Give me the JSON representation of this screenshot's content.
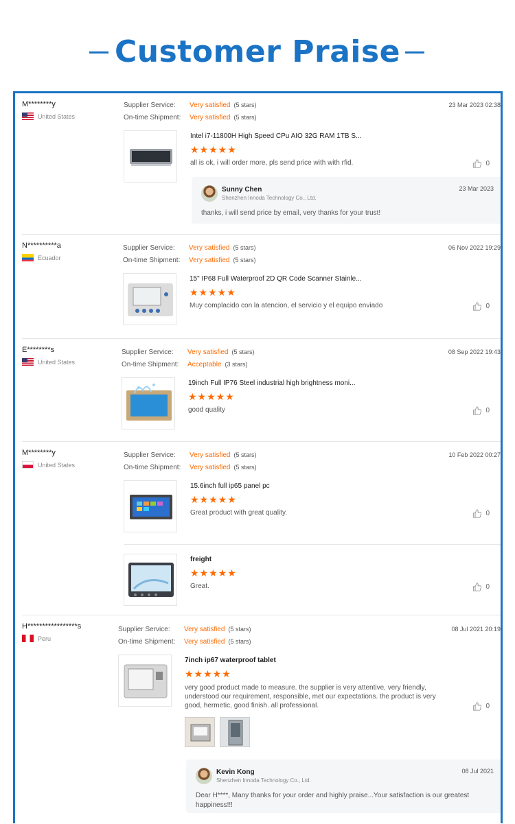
{
  "header": {
    "title": "Customer Praise"
  },
  "labels": {
    "supplier_service": "Supplier Service:",
    "on_time_shipment": "On-time Shipment:"
  },
  "colors": {
    "accent": "#1a73c4",
    "rating": "#ff6a00"
  },
  "reviews": [
    {
      "buyer": "M********y",
      "country": "United States",
      "supplier_service": "Very satisfied",
      "supplier_service_stars": "(5 stars)",
      "shipment": "Very satisfied",
      "shipment_stars": "(5 stars)",
      "date": "23 Mar 2023 02:38",
      "items": [
        {
          "product": "Intel i7-11800H High Speed CPu AIO 32G RAM 1TB S...",
          "stars": "★★★★★",
          "comment": "all is ok, i will order more, pls send price with with rfid.",
          "likes": "0"
        }
      ],
      "reply": {
        "name": "Sunny Chen",
        "company": "Shenzhen Innoda Technology Co., Ltd.",
        "date": "23 Mar 2023",
        "text": "thanks, i will send price by email, very thanks for your trust!"
      }
    },
    {
      "buyer": "N**********a",
      "country": "Ecuador",
      "supplier_service": "Very satisfied",
      "supplier_service_stars": "(5 stars)",
      "shipment": "Very satisfied",
      "shipment_stars": "(5 stars)",
      "date": "06 Nov 2022 19:29",
      "items": [
        {
          "product": "15\" IP68 Full Waterproof 2D QR Code Scanner Stainle...",
          "stars": "★★★★★",
          "comment": "Muy complacido con la atencion, el servicio y el equipo enviado",
          "likes": "0"
        }
      ]
    },
    {
      "buyer": "E********s",
      "country": "United States",
      "supplier_service": "Very satisfied",
      "supplier_service_stars": "(5 stars)",
      "shipment": "Acceptable",
      "shipment_stars": "(3 stars)",
      "date": "08 Sep 2022 19:43",
      "items": [
        {
          "product": "19inch Full IP76 Steel industrial high brightness moni...",
          "stars": "★★★★★",
          "comment": "good quality",
          "likes": "0"
        }
      ]
    },
    {
      "buyer": "M********y",
      "country": "United States",
      "supplier_service": "Very satisfied",
      "supplier_service_stars": "(5 stars)",
      "shipment": "Very satisfied",
      "shipment_stars": "(5 stars)",
      "date": "10 Feb 2022 00:27",
      "items": [
        {
          "product": "15.6inch full ip65 panel pc",
          "stars": "★★★★★",
          "comment": "Great product with great quality.",
          "likes": "0"
        },
        {
          "product": "freight",
          "stars": "★★★★★",
          "comment": "Great.",
          "likes": "0"
        }
      ]
    },
    {
      "buyer": "H*****************s",
      "country": "Peru",
      "supplier_service": "Very satisfied",
      "supplier_service_stars": "(5 stars)",
      "shipment": "Very satisfied",
      "shipment_stars": "(5 stars)",
      "date": "08 Jul 2021 20:19",
      "items": [
        {
          "product": "7inch ip67 waterproof tablet",
          "stars": "★★★★★",
          "comment": "very good product made to measure.  the supplier is very attentive, very friendly, understood our requirement, responsible, met our expectations.  the product is very good, hermetic, good finish.  all professional.",
          "likes": "0"
        }
      ],
      "reply": {
        "name": "Kevin Kong",
        "company": "Shenzhen Innoda Technology Co., Ltd.",
        "date": "08 Jul 2021",
        "text": "Dear H****,   Many thanks for your order and highly praise...Your satisfaction is our greatest happiness!!!"
      }
    }
  ]
}
